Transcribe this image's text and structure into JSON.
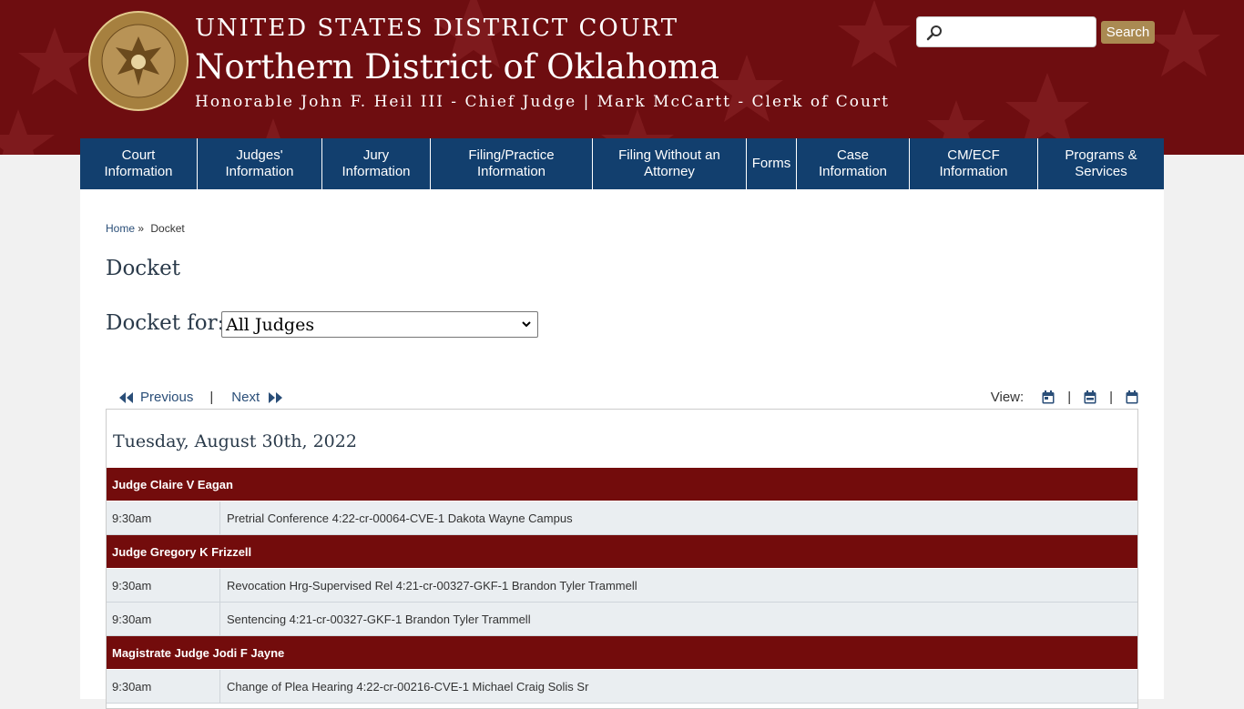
{
  "header": {
    "court": "UNITED STATES DISTRICT COURT",
    "district": "Northern District of Oklahoma",
    "officials": "Honorable John F. Heil III - Chief Judge | Mark McCartt - Clerk of Court",
    "seal_icon": "court-seal-icon"
  },
  "search": {
    "placeholder": "",
    "value": "",
    "button_label": "Search"
  },
  "nav": [
    {
      "label": "Court\nInformation"
    },
    {
      "label": "Judges'\nInformation"
    },
    {
      "label": "Jury\nInformation"
    },
    {
      "label": "Filing/Practice\nInformation"
    },
    {
      "label": "Filing Without an\nAttorney"
    },
    {
      "label": "Forms"
    },
    {
      "label": "Case\nInformation"
    },
    {
      "label": "CM/ECF\nInformation"
    },
    {
      "label": "Programs &\nServices"
    }
  ],
  "breadcrumb": {
    "home": "Home",
    "separator": "»",
    "current": "Docket"
  },
  "page_title": "Docket",
  "docket_filter": {
    "label": "Docket for:",
    "selected": "All Judges"
  },
  "pager": {
    "previous": "Previous",
    "next": "Next",
    "separator": "|"
  },
  "view": {
    "label": "View:",
    "separator": "|",
    "options": [
      "day-view-icon",
      "week-view-icon",
      "month-view-icon"
    ]
  },
  "docket": {
    "date": "Tuesday, August 30th, 2022",
    "groups": [
      {
        "judge": "Judge Claire V Eagan",
        "events": [
          {
            "time": "9:30am",
            "description": "Pretrial Conference 4:22-cr-00064-CVE-1 Dakota Wayne Campus"
          }
        ]
      },
      {
        "judge": "Judge Gregory K Frizzell",
        "events": [
          {
            "time": "9:30am",
            "description": "Revocation Hrg-Supervised Rel 4:21-cr-00327-GKF-1 Brandon Tyler Trammell"
          },
          {
            "time": "9:30am",
            "description": "Sentencing 4:21-cr-00327-GKF-1 Brandon Tyler Trammell"
          }
        ]
      },
      {
        "judge": "Magistrate Judge Jodi F Jayne",
        "events": [
          {
            "time": "9:30am",
            "description": "Change of Plea Hearing 4:22-cr-00216-CVE-1 Michael Craig Solis Sr"
          }
        ]
      }
    ]
  },
  "colors": {
    "header_bg": "#6e0d10",
    "nav_bg": "#123f6e",
    "judge_row_bg": "#730c0c",
    "event_row_bg": "#eaeef1",
    "link": "#2a4e78",
    "search_button": "#aa8a52"
  }
}
